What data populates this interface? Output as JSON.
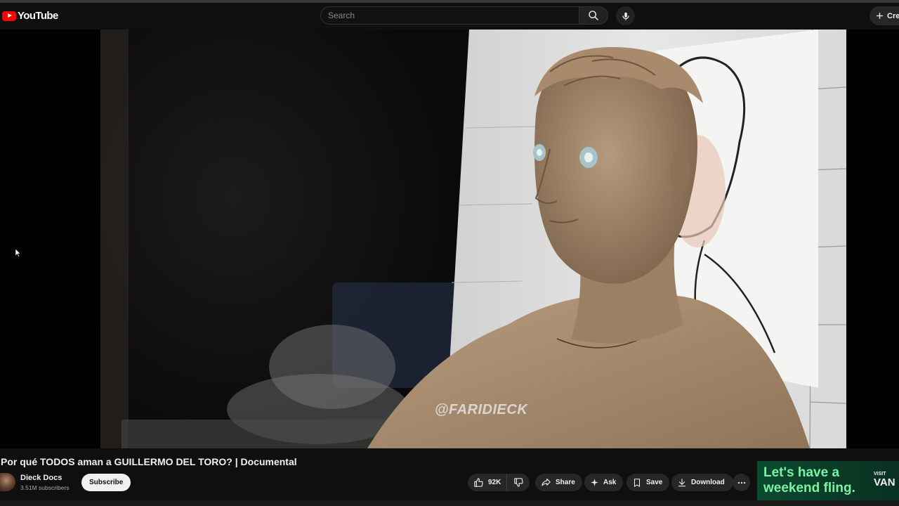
{
  "masthead": {
    "logo_text": "YouTube",
    "search_placeholder": "Search",
    "create_label": "Crea"
  },
  "video": {
    "watermark": "@FARIDIECK",
    "title": "Por qué TODOS aman a GUILLERMO DEL TORO? | Documental"
  },
  "channel": {
    "name": "Dieck Docs",
    "subscribers": "3.51M subscribers",
    "subscribe_label": "Subscribe"
  },
  "actions": {
    "likes": "92K",
    "share": "Share",
    "ask": "Ask",
    "save": "Save",
    "download": "Download"
  },
  "ad": {
    "line1": "Let's have a",
    "line2": "weekend fling.",
    "visit": "VISIT",
    "brand": "VAN"
  },
  "colors": {
    "background": "#0f0f0f",
    "logo_red": "#ff0000",
    "pill_bg": "#272727",
    "ad_text": "#7cf2a2"
  }
}
